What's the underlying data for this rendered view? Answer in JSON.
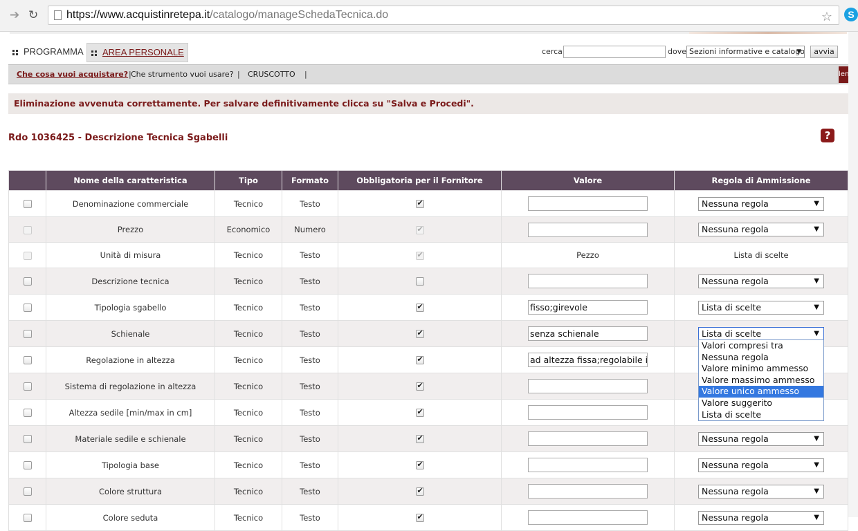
{
  "browser": {
    "url_host": "https://www.acquistinretepa.it",
    "url_path": "/catalogo/manageSchedaTecnica.do"
  },
  "nav": {
    "tabs": [
      "PROGRAMMA",
      "AREA PERSONALE"
    ],
    "search_label": "cerca",
    "search_value": "",
    "where_label": "dove",
    "section_select": "Sezioni informative e catalogo",
    "go_button": "avvia"
  },
  "subnav": {
    "items": [
      "Che cosa vuoi acquistare?",
      "Che strumento vuoi usare?",
      "CRUSCOTTO"
    ],
    "separator": "|",
    "edge_label": "len"
  },
  "message": "Eliminazione avvenuta correttamente. Per salvare definitivamente clicca su \"Salva e Procedi\".",
  "page_title": "Rdo 1036425 - Descrizione Tecnica Sgabelli",
  "help_label": "?",
  "table": {
    "headers": [
      "",
      "Nome della caratteristica",
      "Tipo",
      "Formato",
      "Obbligatoria per il Fornitore",
      "Valore",
      "Regola di Ammissione"
    ],
    "rows": [
      {
        "name": "Denominazione commerciale",
        "tipo": "Tecnico",
        "formato": "Testo",
        "mandatory": true,
        "disabled": false,
        "valore": "",
        "regola": "Nessuna regola"
      },
      {
        "name": "Prezzo",
        "tipo": "Economico",
        "formato": "Numero",
        "mandatory": true,
        "disabled": true,
        "valore": "",
        "regola": "Nessuna regola"
      },
      {
        "name": "Unità di misura",
        "tipo": "Tecnico",
        "formato": "Testo",
        "mandatory": true,
        "disabled": true,
        "valore_text": "Pezzo",
        "regola_text": "Lista di scelte"
      },
      {
        "name": "Descrizione tecnica",
        "tipo": "Tecnico",
        "formato": "Testo",
        "mandatory": false,
        "disabled": false,
        "valore": "",
        "regola": "Nessuna regola"
      },
      {
        "name": "Tipologia sgabello",
        "tipo": "Tecnico",
        "formato": "Testo",
        "mandatory": true,
        "disabled": false,
        "valore": "fisso;girevole",
        "regola": "Lista di scelte"
      },
      {
        "name": "Schienale",
        "tipo": "Tecnico",
        "formato": "Testo",
        "mandatory": true,
        "disabled": false,
        "valore": "senza schienale",
        "regola": "Lista di scelte",
        "open": true
      },
      {
        "name": "Regolazione in altezza",
        "tipo": "Tecnico",
        "formato": "Testo",
        "mandatory": true,
        "disabled": false,
        "valore": "ad altezza fissa;regolabile in",
        "regola": ""
      },
      {
        "name": "Sistema di regolazione in altezza",
        "tipo": "Tecnico",
        "formato": "Testo",
        "mandatory": true,
        "disabled": false,
        "valore": "",
        "regola": ""
      },
      {
        "name": "Altezza sedile [min/max in cm]",
        "tipo": "Tecnico",
        "formato": "Testo",
        "mandatory": true,
        "disabled": false,
        "valore": "",
        "regola": ""
      },
      {
        "name": "Materiale sedile e schienale",
        "tipo": "Tecnico",
        "formato": "Testo",
        "mandatory": true,
        "disabled": false,
        "valore": "",
        "regola": "Nessuna regola"
      },
      {
        "name": "Tipologia base",
        "tipo": "Tecnico",
        "formato": "Testo",
        "mandatory": true,
        "disabled": false,
        "valore": "",
        "regola": "Nessuna regola"
      },
      {
        "name": "Colore struttura",
        "tipo": "Tecnico",
        "formato": "Testo",
        "mandatory": true,
        "disabled": false,
        "valore": "",
        "regola": "Nessuna regola"
      },
      {
        "name": "Colore seduta",
        "tipo": "Tecnico",
        "formato": "Testo",
        "mandatory": true,
        "disabled": false,
        "valore": "",
        "regola": "Nessuna regola"
      }
    ]
  },
  "dropdown_options": [
    "Valori compresi tra",
    "Nessuna regola",
    "Valore minimo ammesso",
    "Valore massimo ammesso",
    "Valore unico ammesso",
    "Valore suggerito",
    "Lista di scelte"
  ],
  "dropdown_highlighted": "Valore unico ammesso"
}
